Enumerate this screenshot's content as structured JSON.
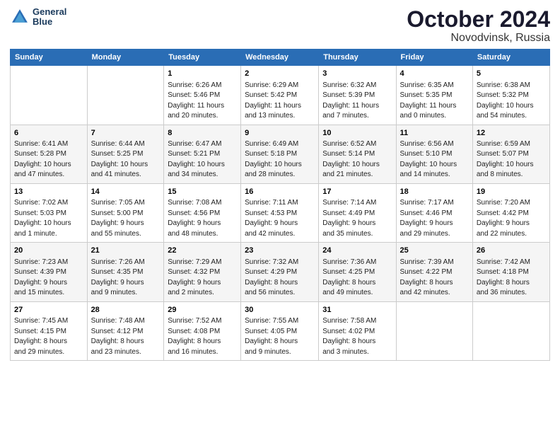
{
  "header": {
    "logo_line1": "General",
    "logo_line2": "Blue",
    "month": "October 2024",
    "location": "Novodvinsk, Russia"
  },
  "weekdays": [
    "Sunday",
    "Monday",
    "Tuesday",
    "Wednesday",
    "Thursday",
    "Friday",
    "Saturday"
  ],
  "weeks": [
    [
      {
        "day": "",
        "detail": ""
      },
      {
        "day": "",
        "detail": ""
      },
      {
        "day": "1",
        "detail": "Sunrise: 6:26 AM\nSunset: 5:46 PM\nDaylight: 11 hours\nand 20 minutes."
      },
      {
        "day": "2",
        "detail": "Sunrise: 6:29 AM\nSunset: 5:42 PM\nDaylight: 11 hours\nand 13 minutes."
      },
      {
        "day": "3",
        "detail": "Sunrise: 6:32 AM\nSunset: 5:39 PM\nDaylight: 11 hours\nand 7 minutes."
      },
      {
        "day": "4",
        "detail": "Sunrise: 6:35 AM\nSunset: 5:35 PM\nDaylight: 11 hours\nand 0 minutes."
      },
      {
        "day": "5",
        "detail": "Sunrise: 6:38 AM\nSunset: 5:32 PM\nDaylight: 10 hours\nand 54 minutes."
      }
    ],
    [
      {
        "day": "6",
        "detail": "Sunrise: 6:41 AM\nSunset: 5:28 PM\nDaylight: 10 hours\nand 47 minutes."
      },
      {
        "day": "7",
        "detail": "Sunrise: 6:44 AM\nSunset: 5:25 PM\nDaylight: 10 hours\nand 41 minutes."
      },
      {
        "day": "8",
        "detail": "Sunrise: 6:47 AM\nSunset: 5:21 PM\nDaylight: 10 hours\nand 34 minutes."
      },
      {
        "day": "9",
        "detail": "Sunrise: 6:49 AM\nSunset: 5:18 PM\nDaylight: 10 hours\nand 28 minutes."
      },
      {
        "day": "10",
        "detail": "Sunrise: 6:52 AM\nSunset: 5:14 PM\nDaylight: 10 hours\nand 21 minutes."
      },
      {
        "day": "11",
        "detail": "Sunrise: 6:56 AM\nSunset: 5:10 PM\nDaylight: 10 hours\nand 14 minutes."
      },
      {
        "day": "12",
        "detail": "Sunrise: 6:59 AM\nSunset: 5:07 PM\nDaylight: 10 hours\nand 8 minutes."
      }
    ],
    [
      {
        "day": "13",
        "detail": "Sunrise: 7:02 AM\nSunset: 5:03 PM\nDaylight: 10 hours\nand 1 minute."
      },
      {
        "day": "14",
        "detail": "Sunrise: 7:05 AM\nSunset: 5:00 PM\nDaylight: 9 hours\nand 55 minutes."
      },
      {
        "day": "15",
        "detail": "Sunrise: 7:08 AM\nSunset: 4:56 PM\nDaylight: 9 hours\nand 48 minutes."
      },
      {
        "day": "16",
        "detail": "Sunrise: 7:11 AM\nSunset: 4:53 PM\nDaylight: 9 hours\nand 42 minutes."
      },
      {
        "day": "17",
        "detail": "Sunrise: 7:14 AM\nSunset: 4:49 PM\nDaylight: 9 hours\nand 35 minutes."
      },
      {
        "day": "18",
        "detail": "Sunrise: 7:17 AM\nSunset: 4:46 PM\nDaylight: 9 hours\nand 29 minutes."
      },
      {
        "day": "19",
        "detail": "Sunrise: 7:20 AM\nSunset: 4:42 PM\nDaylight: 9 hours\nand 22 minutes."
      }
    ],
    [
      {
        "day": "20",
        "detail": "Sunrise: 7:23 AM\nSunset: 4:39 PM\nDaylight: 9 hours\nand 15 minutes."
      },
      {
        "day": "21",
        "detail": "Sunrise: 7:26 AM\nSunset: 4:35 PM\nDaylight: 9 hours\nand 9 minutes."
      },
      {
        "day": "22",
        "detail": "Sunrise: 7:29 AM\nSunset: 4:32 PM\nDaylight: 9 hours\nand 2 minutes."
      },
      {
        "day": "23",
        "detail": "Sunrise: 7:32 AM\nSunset: 4:29 PM\nDaylight: 8 hours\nand 56 minutes."
      },
      {
        "day": "24",
        "detail": "Sunrise: 7:36 AM\nSunset: 4:25 PM\nDaylight: 8 hours\nand 49 minutes."
      },
      {
        "day": "25",
        "detail": "Sunrise: 7:39 AM\nSunset: 4:22 PM\nDaylight: 8 hours\nand 42 minutes."
      },
      {
        "day": "26",
        "detail": "Sunrise: 7:42 AM\nSunset: 4:18 PM\nDaylight: 8 hours\nand 36 minutes."
      }
    ],
    [
      {
        "day": "27",
        "detail": "Sunrise: 7:45 AM\nSunset: 4:15 PM\nDaylight: 8 hours\nand 29 minutes."
      },
      {
        "day": "28",
        "detail": "Sunrise: 7:48 AM\nSunset: 4:12 PM\nDaylight: 8 hours\nand 23 minutes."
      },
      {
        "day": "29",
        "detail": "Sunrise: 7:52 AM\nSunset: 4:08 PM\nDaylight: 8 hours\nand 16 minutes."
      },
      {
        "day": "30",
        "detail": "Sunrise: 7:55 AM\nSunset: 4:05 PM\nDaylight: 8 hours\nand 9 minutes."
      },
      {
        "day": "31",
        "detail": "Sunrise: 7:58 AM\nSunset: 4:02 PM\nDaylight: 8 hours\nand 3 minutes."
      },
      {
        "day": "",
        "detail": ""
      },
      {
        "day": "",
        "detail": ""
      }
    ]
  ]
}
